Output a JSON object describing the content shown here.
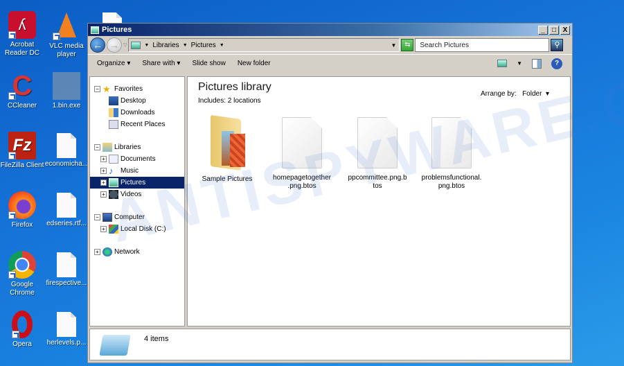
{
  "desktop": {
    "icons": [
      {
        "label": "Acrobat Reader DC",
        "icon": "acrobat-icon",
        "color": "#c8102e"
      },
      {
        "label": "VLC media player",
        "icon": "vlc-icon",
        "color": "#f08020"
      },
      {
        "label": "CCleaner",
        "icon": "ccleaner-icon",
        "color": "#d33"
      },
      {
        "label": "1.bin.exe",
        "icon": "exe-icon",
        "color": "#6f8fb0"
      },
      {
        "label": "FileZilla Client",
        "icon": "filezilla-icon",
        "color": "#b21"
      },
      {
        "label": "economicha...",
        "icon": "file-icon"
      },
      {
        "label": "Firefox",
        "icon": "firefox-icon",
        "color": "#e66000"
      },
      {
        "label": "edseries.rtf...",
        "icon": "file-icon"
      },
      {
        "label": "Google Chrome",
        "icon": "chrome-icon",
        "color": "#4285f4"
      },
      {
        "label": "firespective...",
        "icon": "file-icon"
      },
      {
        "label": "Opera",
        "icon": "opera-icon",
        "color": "#cc0f16"
      },
      {
        "label": "herlevels.p...",
        "icon": "file-icon"
      }
    ]
  },
  "window": {
    "title": "Pictures",
    "controls": {
      "minimize": "_",
      "maximize": "□",
      "close": "X"
    },
    "address": {
      "crumbs": [
        "Libraries",
        "Pictures"
      ]
    },
    "search": {
      "placeholder": "Search Pictures"
    },
    "commands": [
      "Organize",
      "Share with",
      "Slide show",
      "New folder"
    ],
    "command_dropdowns": [
      true,
      true,
      false,
      false
    ]
  },
  "nav": {
    "groups": [
      {
        "label": "Favorites",
        "icon": "star-icon",
        "items": [
          "Desktop",
          "Downloads",
          "Recent Places"
        ]
      },
      {
        "label": "Libraries",
        "icon": "library-icon",
        "items": [
          "Documents",
          "Music",
          "Pictures",
          "Videos"
        ],
        "selected": "Pictures"
      },
      {
        "label": "Computer",
        "icon": "computer-icon",
        "items": [
          "Local Disk (C:)"
        ]
      },
      {
        "label": "Network",
        "icon": "network-icon",
        "items": []
      }
    ]
  },
  "content": {
    "title": "Pictures library",
    "subtitle": "Includes:  2 locations",
    "arrange_label": "Arrange by:",
    "arrange_value": "Folder",
    "items": [
      {
        "name": "Sample Pictures",
        "type": "folder"
      },
      {
        "name": "homepagetogether\n.png.btos",
        "type": "file"
      },
      {
        "name": "ppcommittee.png.b\ntos",
        "type": "file"
      },
      {
        "name": "problemsfunctional.\npng.btos",
        "type": "file"
      }
    ]
  },
  "status": {
    "count": "4 items"
  },
  "watermark": "ANTISPYWARE.CO"
}
